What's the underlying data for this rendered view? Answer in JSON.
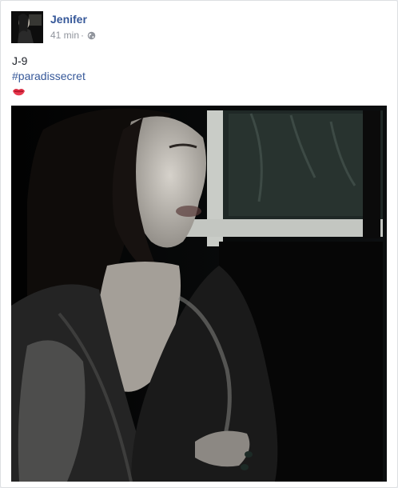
{
  "post": {
    "author_name": "Jenifer",
    "timestamp": "41 min",
    "separator": "·",
    "privacy_icon": "globe-icon",
    "text_line_1": "J-9",
    "hashtag": "#paradissecret",
    "emoji_icon": "kiss-lips-icon"
  },
  "colors": {
    "link": "#365899",
    "meta": "#90949c",
    "text": "#1d2129"
  }
}
